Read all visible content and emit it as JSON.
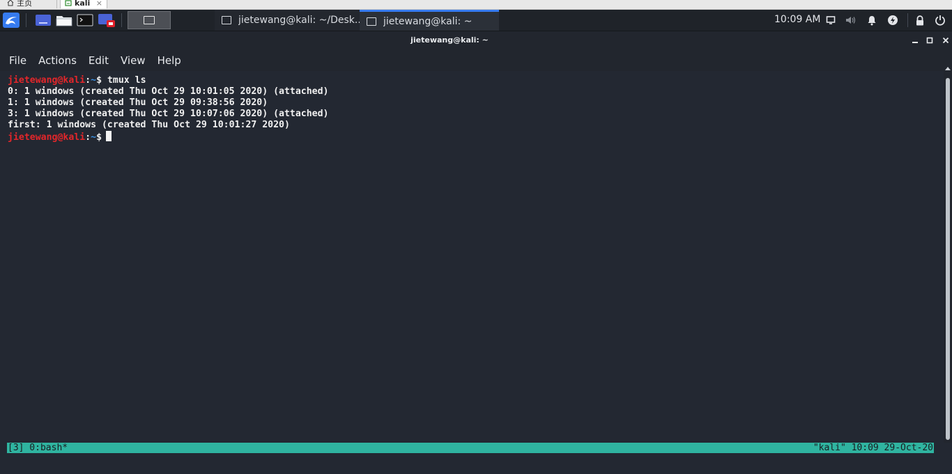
{
  "host_browser": {
    "tabs": [
      {
        "label": "主页",
        "icon": "home-icon"
      },
      {
        "label": "kali",
        "icon": "vm-icon",
        "close": "×"
      }
    ]
  },
  "panel": {
    "launchers": [
      "kali-menu-icon",
      "show-desktop-icon",
      "file-manager-icon",
      "terminal-icon",
      "screen-recorder-icon"
    ],
    "workspace_icon": "window-icon",
    "tasks": [
      {
        "label": "jietewang@kali: ~/Desk...",
        "icon": "terminal-window-icon"
      },
      {
        "label": "jietewang@kali: ~",
        "icon": "terminal-window-icon",
        "active": true
      }
    ],
    "clock": "10:09 AM",
    "tray": [
      "display-icon",
      "volume-icon",
      "notification-bell-icon",
      "power-icon",
      "lock-icon",
      "logout-icon"
    ],
    "accent": "#367bf0"
  },
  "window": {
    "title": "jietewang@kali: ~",
    "controls": [
      "minimize-icon",
      "maximize-icon",
      "close-icon"
    ],
    "menu": [
      "File",
      "Actions",
      "Edit",
      "View",
      "Help"
    ]
  },
  "terminal": {
    "prompt_user": "jietewang@kali",
    "prompt_sep": ":",
    "prompt_path": "~",
    "prompt_symbol": "$",
    "command": " tmux ls",
    "output": [
      "0: 1 windows (created Thu Oct 29 10:01:05 2020) (attached)",
      "1: 1 windows (created Thu Oct 29 09:38:56 2020)",
      "3: 1 windows (created Thu Oct 29 10:07:06 2020) (attached)",
      "first: 1 windows (created Thu Oct 29 10:01:27 2020)"
    ],
    "colors": {
      "user": "#e4262a",
      "path": "#3a8fe0",
      "text": "#f0f0f0",
      "background": "#232832"
    }
  },
  "tmux_status": {
    "left": "[3] 0:bash*",
    "right": "\"kali\" 10:09 29-Oct-20",
    "color": "#2fb4a0"
  }
}
